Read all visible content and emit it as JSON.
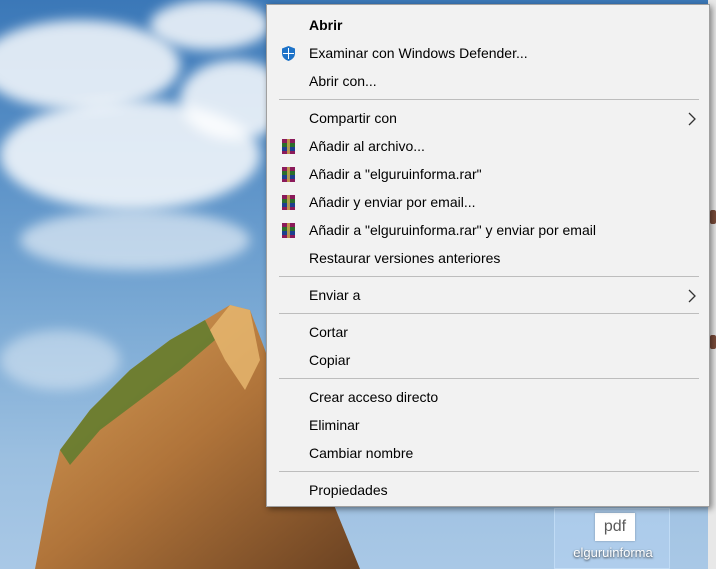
{
  "menu": {
    "items": [
      {
        "label": "Abrir",
        "bold": true
      },
      {
        "label": "Examinar con Windows Defender...",
        "icon": "windows-defender-icon"
      },
      {
        "label": "Abrir con..."
      },
      {
        "label": "Compartir con",
        "submenu": true
      },
      {
        "label": "Añadir al archivo...",
        "icon": "winrar-icon"
      },
      {
        "label": "Añadir a \"elguruinforma.rar\"",
        "icon": "winrar-icon"
      },
      {
        "label": "Añadir y enviar por email...",
        "icon": "winrar-icon"
      },
      {
        "label": "Añadir a \"elguruinforma.rar\" y enviar por email",
        "icon": "winrar-icon"
      },
      {
        "label": "Restaurar versiones anteriores"
      },
      {
        "label": "Enviar a",
        "submenu": true
      },
      {
        "label": "Cortar"
      },
      {
        "label": "Copiar"
      },
      {
        "label": "Crear acceso directo"
      },
      {
        "label": "Eliminar"
      },
      {
        "label": "Cambiar nombre"
      },
      {
        "label": "Propiedades"
      }
    ]
  },
  "desktop_icon": {
    "file_type": "pdf",
    "name": "elguruinforma"
  },
  "colors": {
    "menu_bg": "#f2f2f2",
    "separator": "#bdbdbd",
    "defender_blue": "#1e73c8"
  }
}
